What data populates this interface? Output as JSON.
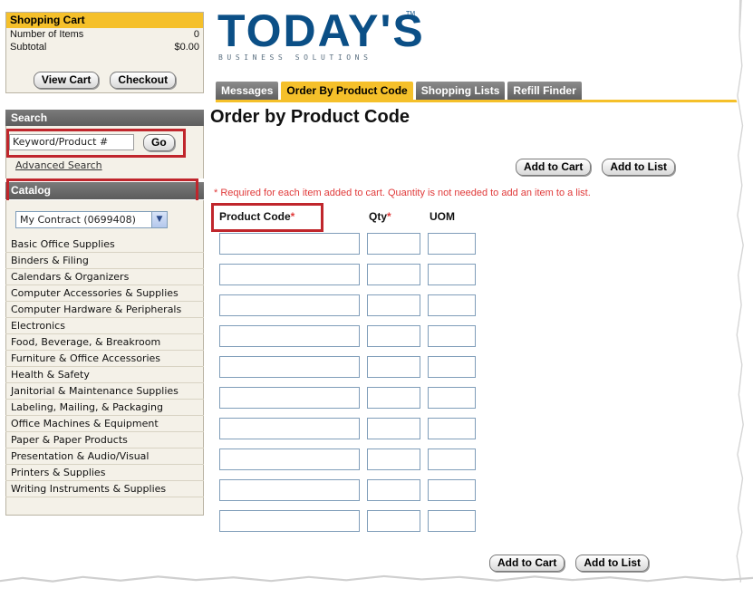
{
  "cart": {
    "title": "Shopping Cart",
    "items_label": "Number of Items",
    "items_value": "0",
    "subtotal_label": "Subtotal",
    "subtotal_value": "$0.00",
    "view_cart": "View Cart",
    "checkout": "Checkout"
  },
  "search": {
    "title": "Search",
    "value": "Keyword/Product #",
    "go": "Go",
    "advanced": "Advanced Search"
  },
  "catalog": {
    "title": "Catalog",
    "selected": "My Contract (0699408)",
    "categories": [
      "Basic Office Supplies",
      "Binders & Filing",
      "Calendars & Organizers",
      "Computer Accessories & Supplies",
      "Computer Hardware & Peripherals",
      "Electronics",
      "Food, Beverage, & Breakroom",
      "Furniture & Office Accessories",
      "Health & Safety",
      "Janitorial & Maintenance Supplies",
      "Labeling, Mailing, & Packaging",
      "Office Machines & Equipment",
      "Paper & Paper Products",
      "Presentation & Audio/Visual",
      "Printers & Supplies",
      "Writing Instruments & Supplies"
    ]
  },
  "logo": {
    "text": "TODAY'S",
    "tm": "TM",
    "subtitle": "BUSINESS SOLUTIONS"
  },
  "tabs": [
    "Messages",
    "Order By Product Code",
    "Shopping Lists",
    "Refill Finder"
  ],
  "main": {
    "title": "Order by Product Code",
    "add_to_cart": "Add to Cart",
    "add_to_list": "Add to List",
    "required_note": "* Required for each item added to cart. Quantity is not needed to add an item to a list.",
    "col_product": "Product Code",
    "col_qty": "Qty",
    "col_uom": "UOM",
    "required_star": "*",
    "row_count": 10
  },
  "colors": {
    "accent_yellow": "#f5c02a",
    "logo_blue": "#0b4f86",
    "highlight_red": "#c0262c",
    "required_red": "#e03a3a"
  }
}
